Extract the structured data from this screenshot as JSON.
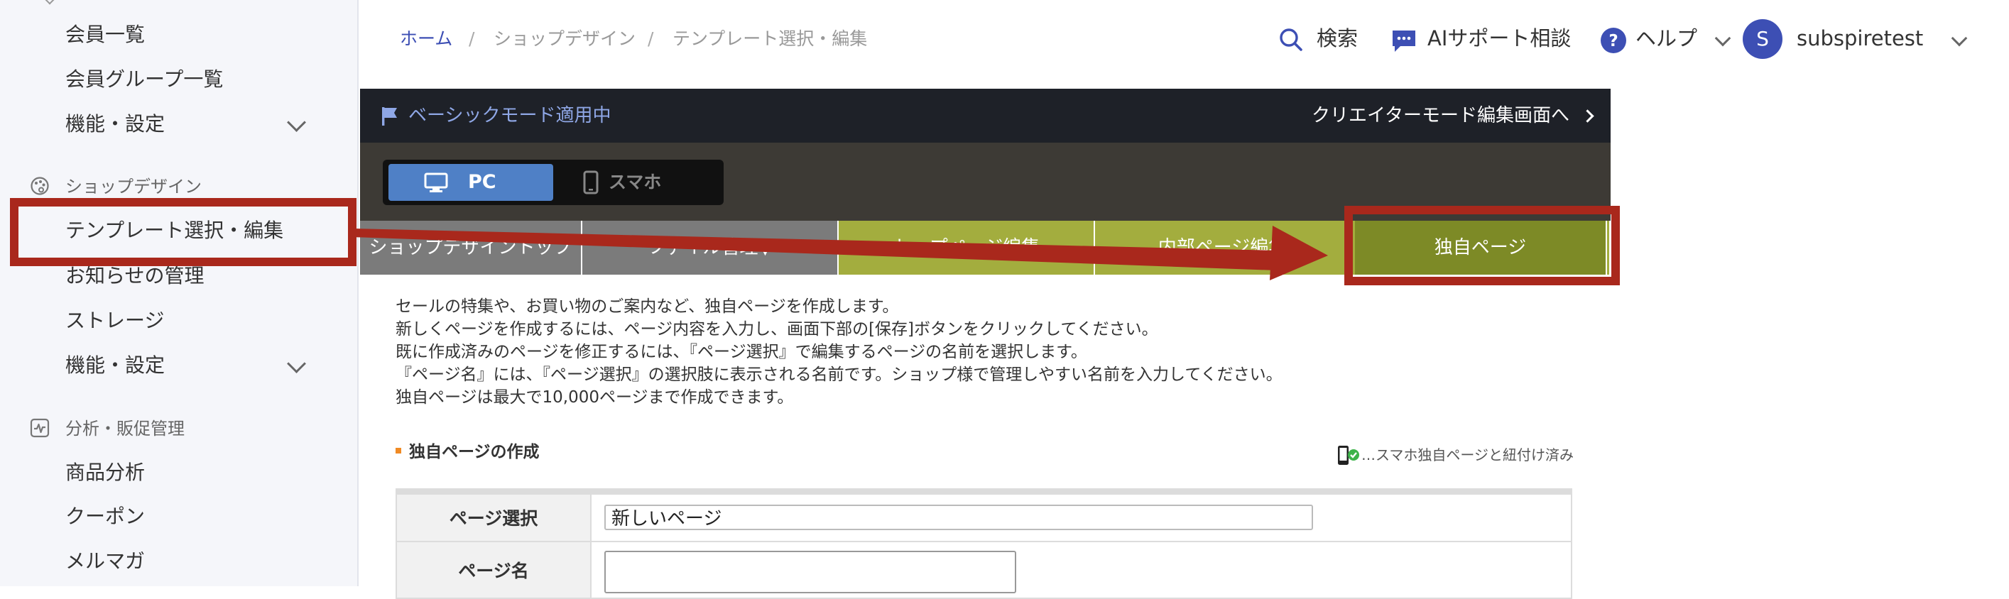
{
  "sidebar": {
    "items_top": [
      {
        "label": "会員一覧"
      },
      {
        "label": "会員グループ一覧"
      },
      {
        "label": "機能・設定"
      }
    ],
    "shop_design": {
      "title": "ショップデザイン",
      "items": [
        {
          "label": "テンプレート選択・編集"
        },
        {
          "label": "お知らせの管理"
        },
        {
          "label": "ストレージ"
        },
        {
          "label": "機能・設定"
        }
      ]
    },
    "analytics": {
      "title": "分析・販促管理",
      "items": [
        {
          "label": "商品分析"
        },
        {
          "label": "クーポン"
        },
        {
          "label": "メルマガ"
        }
      ]
    }
  },
  "header": {
    "breadcrumb": [
      "ホーム",
      "/",
      "ショップデザイン",
      "/",
      "テンプレート選択・編集"
    ],
    "search_label": "検索",
    "ai_label": "AIサポート相談",
    "help_label": "ヘルプ",
    "avatar_initial": "S",
    "username": "subspiretest"
  },
  "modebar": {
    "mode_label": "ベーシックモード適用中",
    "creator_link": "クリエイターモード編集画面へ"
  },
  "device_toggle": {
    "pc_label": "PC",
    "sp_label": "スマホ"
  },
  "tabs": [
    {
      "label": "ショップデザイントップ"
    },
    {
      "label": "ファイル管理▼"
    },
    {
      "label": "トップページ編集"
    },
    {
      "label": "内部ページ編集"
    },
    {
      "label": "独自ページ"
    }
  ],
  "description": [
    "セールの特集や、お買い物のご案内など、独自ページを作成します。",
    "新しくページを作成するには、ページ内容を入力し、画面下部の[保存]ボタンをクリックしてください。",
    "既に作成済みのページを修正するには、『ページ選択』で編集するページの名前を選択します。",
    "『ページ名』には、『ページ選択』の選択肢に表示される名前です。ショップ様で管理しやすい名前を入力してください。",
    "独自ページは最大で10,000ページまで作成できます。"
  ],
  "section": {
    "title": "独自ページの作成",
    "linked_note": "…スマホ独自ページと紐付け済み"
  },
  "form": {
    "page_select_label": "ページ選択",
    "page_select_value": "新しいページ",
    "page_name_label": "ページ名",
    "page_name_value": ""
  },
  "colors": {
    "accent_blue": "#3d4fb4",
    "annotation_red": "#a9281c",
    "tab_gray": "#7b7b7b",
    "tab_green": "#a3ad3e",
    "tab_active_green": "#7d8a26",
    "pc_button_blue": "#4f80c6"
  }
}
